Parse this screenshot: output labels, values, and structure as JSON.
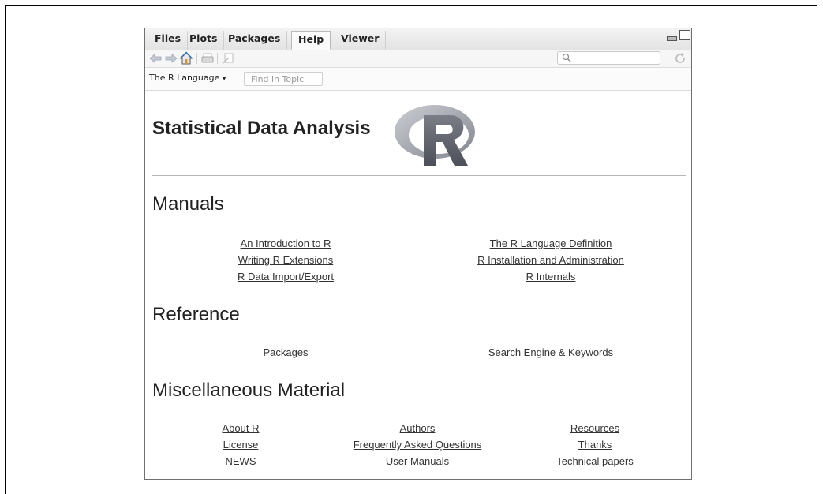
{
  "tabs": [
    {
      "label": "Files"
    },
    {
      "label": "Plots"
    },
    {
      "label": "Packages"
    },
    {
      "label": "Help",
      "active": true
    },
    {
      "label": "Viewer"
    }
  ],
  "toolbar": {
    "icons": [
      "back-arrow-icon",
      "forward-arrow-icon",
      "home-icon",
      "print-icon",
      "open-in-window-icon",
      "search-icon",
      "refresh-icon"
    ],
    "search_placeholder": ""
  },
  "topicbar": {
    "language": "The R Language",
    "language_caret": "▾",
    "find_placeholder": "Find in Topic"
  },
  "page": {
    "title": "Statistical Data Analysis",
    "logo": "R-logo"
  },
  "sections": {
    "manuals": {
      "heading": "Manuals",
      "links": [
        "An Introduction to R",
        "The R Language Definition",
        "Writing R Extensions",
        "R Installation and Administration",
        "R Data Import/Export",
        "R Internals"
      ]
    },
    "reference": {
      "heading": "Reference",
      "links": [
        "Packages",
        "Search Engine & Keywords"
      ]
    },
    "misc": {
      "heading": "Miscellaneous Material",
      "links": [
        "About R",
        "Authors",
        "Resources",
        "License",
        "Frequently Asked Questions",
        "Thanks",
        "NEWS",
        "User Manuals",
        "Technical papers"
      ]
    }
  },
  "colors": {
    "link": "#333333",
    "logo_ring": "#9c9ea6",
    "logo_letter": "#5a5d66"
  }
}
